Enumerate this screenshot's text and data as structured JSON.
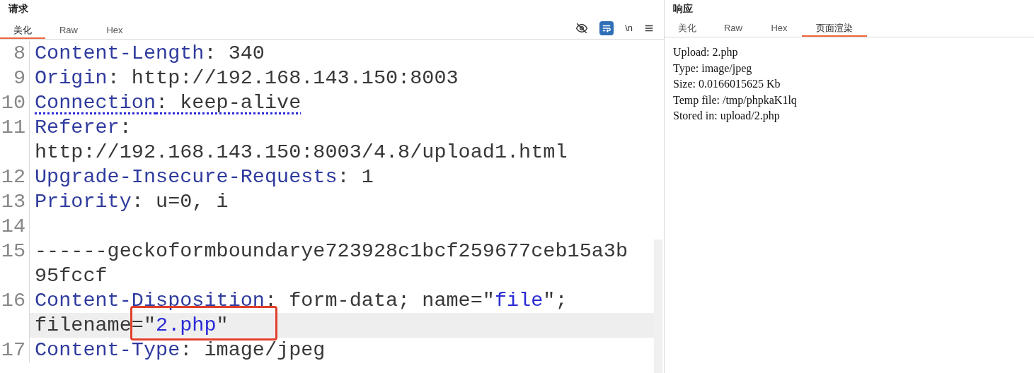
{
  "request": {
    "title": "请求",
    "tabs": [
      {
        "label": "美化",
        "selected": true
      },
      {
        "label": "Raw",
        "selected": false
      },
      {
        "label": "Hex",
        "selected": false
      }
    ],
    "toolbar": {
      "wrap_on": true,
      "newline_label": "\\n"
    },
    "rows": [
      {
        "number": "8",
        "highlighted": false,
        "underlined": false,
        "segments": [
          {
            "kind": "key",
            "text": "Content-Length"
          },
          {
            "kind": "text",
            "text": ": 340"
          }
        ]
      },
      {
        "number": "9",
        "highlighted": false,
        "underlined": false,
        "segments": [
          {
            "kind": "key",
            "text": "Origin"
          },
          {
            "kind": "text",
            "text": ": http://192.168.143.150:8003"
          }
        ]
      },
      {
        "number": "10",
        "highlighted": false,
        "underlined": true,
        "segments": [
          {
            "kind": "key",
            "text": "Connection"
          },
          {
            "kind": "text",
            "text": ": keep-alive"
          }
        ]
      },
      {
        "number": "11",
        "highlighted": false,
        "underlined": false,
        "segments": [
          {
            "kind": "key",
            "text": "Referer"
          },
          {
            "kind": "text",
            "text": ":"
          }
        ]
      },
      {
        "highlighted": false,
        "underlined": false,
        "segments": [
          {
            "kind": "text",
            "text": "http://192.168.143.150:8003/4.8/upload1.html"
          }
        ]
      },
      {
        "number": "12",
        "highlighted": false,
        "underlined": false,
        "segments": [
          {
            "kind": "key",
            "text": "Upgrade-Insecure-Requests"
          },
          {
            "kind": "text",
            "text": ": 1"
          }
        ]
      },
      {
        "number": "13",
        "highlighted": false,
        "underlined": false,
        "segments": [
          {
            "kind": "key",
            "text": "Priority"
          },
          {
            "kind": "text",
            "text": ": u=0, i"
          }
        ]
      },
      {
        "number": "14",
        "highlighted": false,
        "segments": []
      },
      {
        "number": "15",
        "highlighted": false,
        "underlined": false,
        "segments": [
          {
            "kind": "text",
            "text": "------geckoformboundarye723928c1bcf259677ceb15a3b"
          }
        ]
      },
      {
        "highlighted": false,
        "underlined": false,
        "segments": [
          {
            "kind": "text",
            "text": "95fccf"
          }
        ]
      },
      {
        "number": "16",
        "highlighted": false,
        "underlined": false,
        "segments": [
          {
            "kind": "key",
            "text": "Content-Disposition"
          },
          {
            "kind": "text",
            "text": ": form-data; name=\""
          },
          {
            "kind": "string",
            "text": "file"
          },
          {
            "kind": "text",
            "text": "\";"
          }
        ]
      },
      {
        "highlighted": true,
        "underlined": false,
        "segments": [
          {
            "kind": "text",
            "text": "filename"
          },
          {
            "kind": "boxed_start",
            "text": "=\""
          },
          {
            "kind": "string",
            "text": "2.php"
          },
          {
            "kind": "text",
            "text": "\""
          }
        ]
      },
      {
        "number": "17",
        "highlighted": false,
        "underlined": false,
        "segments": [
          {
            "kind": "key",
            "text": "Content-Type"
          },
          {
            "kind": "text",
            "text": ": image/jpeg"
          }
        ]
      }
    ]
  },
  "response": {
    "title": "响应",
    "tabs": [
      {
        "label": "美化",
        "selected": false
      },
      {
        "label": "Raw",
        "selected": false
      },
      {
        "label": "Hex",
        "selected": false
      },
      {
        "label": "页面渲染",
        "selected": true
      }
    ],
    "lines": [
      "Upload: 2.php",
      "Type: image/jpeg",
      "Size: 0.0166015625 Kb",
      "Temp file: /tmp/phpkaK1lq",
      "Stored in: upload/2.php"
    ]
  }
}
